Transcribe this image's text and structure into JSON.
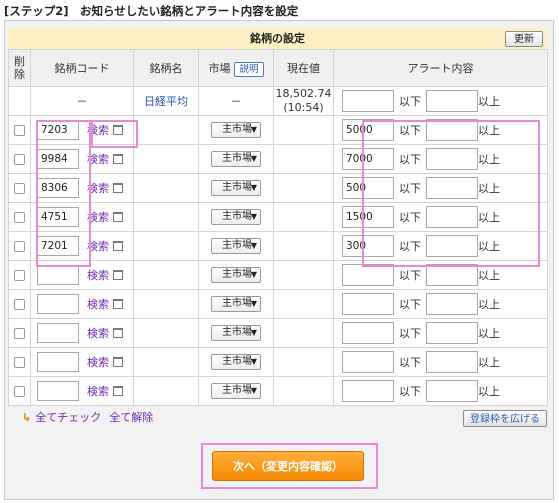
{
  "step_title": "[ステップ2]　お知らせしたい銘柄とアラート内容を設定",
  "section_title": "銘柄の設定",
  "update_button": "更新",
  "columns": {
    "delete": "削除",
    "code": "銘柄コード",
    "name": "銘柄名",
    "market": "市場",
    "market_help": "説明",
    "price": "現在値",
    "alert": "アラート内容"
  },
  "index_row": {
    "code": "－",
    "name": "日経平均",
    "market": "－",
    "price": "18,502.74",
    "time": "(10:54)",
    "below_label": "以下",
    "above_label": "以上"
  },
  "rows": [
    {
      "code": "7203",
      "search": "検索",
      "market": "主市場",
      "below_value": "5000",
      "below_label": "以下",
      "above_value": "",
      "above_label": "以上"
    },
    {
      "code": "9984",
      "search": "検索",
      "market": "主市場",
      "below_value": "7000",
      "below_label": "以下",
      "above_value": "",
      "above_label": "以上"
    },
    {
      "code": "8306",
      "search": "検索",
      "market": "主市場",
      "below_value": "500",
      "below_label": "以下",
      "above_value": "",
      "above_label": "以上"
    },
    {
      "code": "4751",
      "search": "検索",
      "market": "主市場",
      "below_value": "1500",
      "below_label": "以下",
      "above_value": "",
      "above_label": "以上"
    },
    {
      "code": "7201",
      "search": "検索",
      "market": "主市場",
      "below_value": "300",
      "below_label": "以下",
      "above_value": "",
      "above_label": "以上"
    },
    {
      "code": "",
      "search": "検索",
      "market": "主市場",
      "below_value": "",
      "below_label": "以下",
      "above_value": "",
      "above_label": "以上"
    },
    {
      "code": "",
      "search": "検索",
      "market": "主市場",
      "below_value": "",
      "below_label": "以下",
      "above_value": "",
      "above_label": "以上"
    },
    {
      "code": "",
      "search": "検索",
      "market": "主市場",
      "below_value": "",
      "below_label": "以下",
      "above_value": "",
      "above_label": "以上"
    },
    {
      "code": "",
      "search": "検索",
      "market": "主市場",
      "below_value": "",
      "below_label": "以下",
      "above_value": "",
      "above_label": "以上"
    },
    {
      "code": "",
      "search": "検索",
      "market": "主市場",
      "below_value": "",
      "below_label": "以下",
      "above_value": "",
      "above_label": "以上"
    }
  ],
  "bottom": {
    "check_all": "全てチェック",
    "uncheck_all": "全て解除",
    "expand_button": "登録枠を広げる",
    "next_button": "次へ（変更内容確認）"
  },
  "colors": {
    "highlight": "#e889d6",
    "next_button": "#f58a00",
    "header_band": "#fdf0c5",
    "link": "#6f2da8"
  }
}
